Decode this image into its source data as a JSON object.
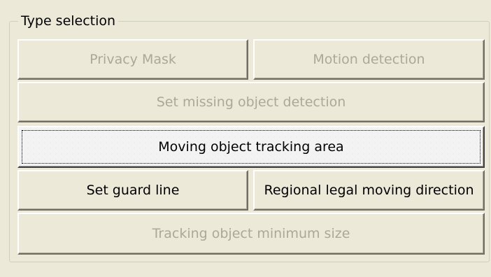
{
  "group": {
    "title": "Type selection"
  },
  "buttons": {
    "privacy_mask": "Privacy Mask",
    "motion_detection": "Motion detection",
    "missing_object": "Set missing object detection",
    "tracking_area": "Moving object tracking area",
    "guard_line": "Set guard line",
    "legal_direction": "Regional legal moving direction",
    "min_size": "Tracking object minimum size"
  },
  "colors": {
    "face": "#ece9d8",
    "disabled_text": "#aca899",
    "shadow": "#716f64",
    "highlight": "#ffffff"
  }
}
